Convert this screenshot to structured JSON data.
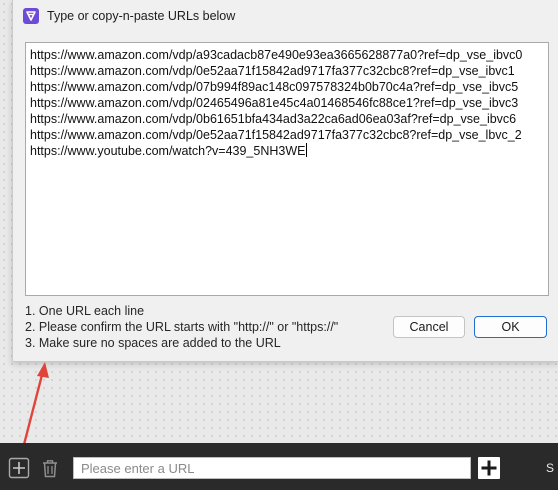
{
  "dialog": {
    "title": "Type or copy-n-paste URLs below",
    "urls": [
      "https://www.amazon.com/vdp/a93cadacb87e490e93ea3665628877a0?ref=dp_vse_ibvc0",
      "https://www.amazon.com/vdp/0e52aa71f15842ad9717fa377c32cbc8?ref=dp_vse_ibvc1",
      "https://www.amazon.com/vdp/07b994f89ac148c097578324b0b70c4a?ref=dp_vse_ibvc5",
      "https://www.amazon.com/vdp/02465496a81e45c4a01468546fc88ce1?ref=dp_vse_ibvc3",
      "https://www.amazon.com/vdp/0b61651bfa434ad3a22ca6ad06ea03af?ref=dp_vse_ibvc6",
      "https://www.amazon.com/vdp/0e52aa71f15842ad9717fa377c32cbc8?ref=dp_vse_lbvc_2",
      "https://www.youtube.com/watch?v=439_5NH3WE"
    ],
    "instructions": [
      "1. One URL each line",
      "2. Please confirm the URL starts with \"http://\" or \"https://\"",
      "3. Make sure no spaces are added to the URL"
    ],
    "cancel_label": "Cancel",
    "ok_label": "OK",
    "accent_color": "#1f6fd0",
    "app_icon_color": "#6f4ad6"
  },
  "annotation": {
    "arrow_color": "#e0453a"
  },
  "toolbar": {
    "add_icon": "plus-box-icon",
    "trash_icon": "trash-icon",
    "url_placeholder": "Please enter a URL",
    "add_url_icon": "plus-icon",
    "cut_off_text": "S"
  }
}
